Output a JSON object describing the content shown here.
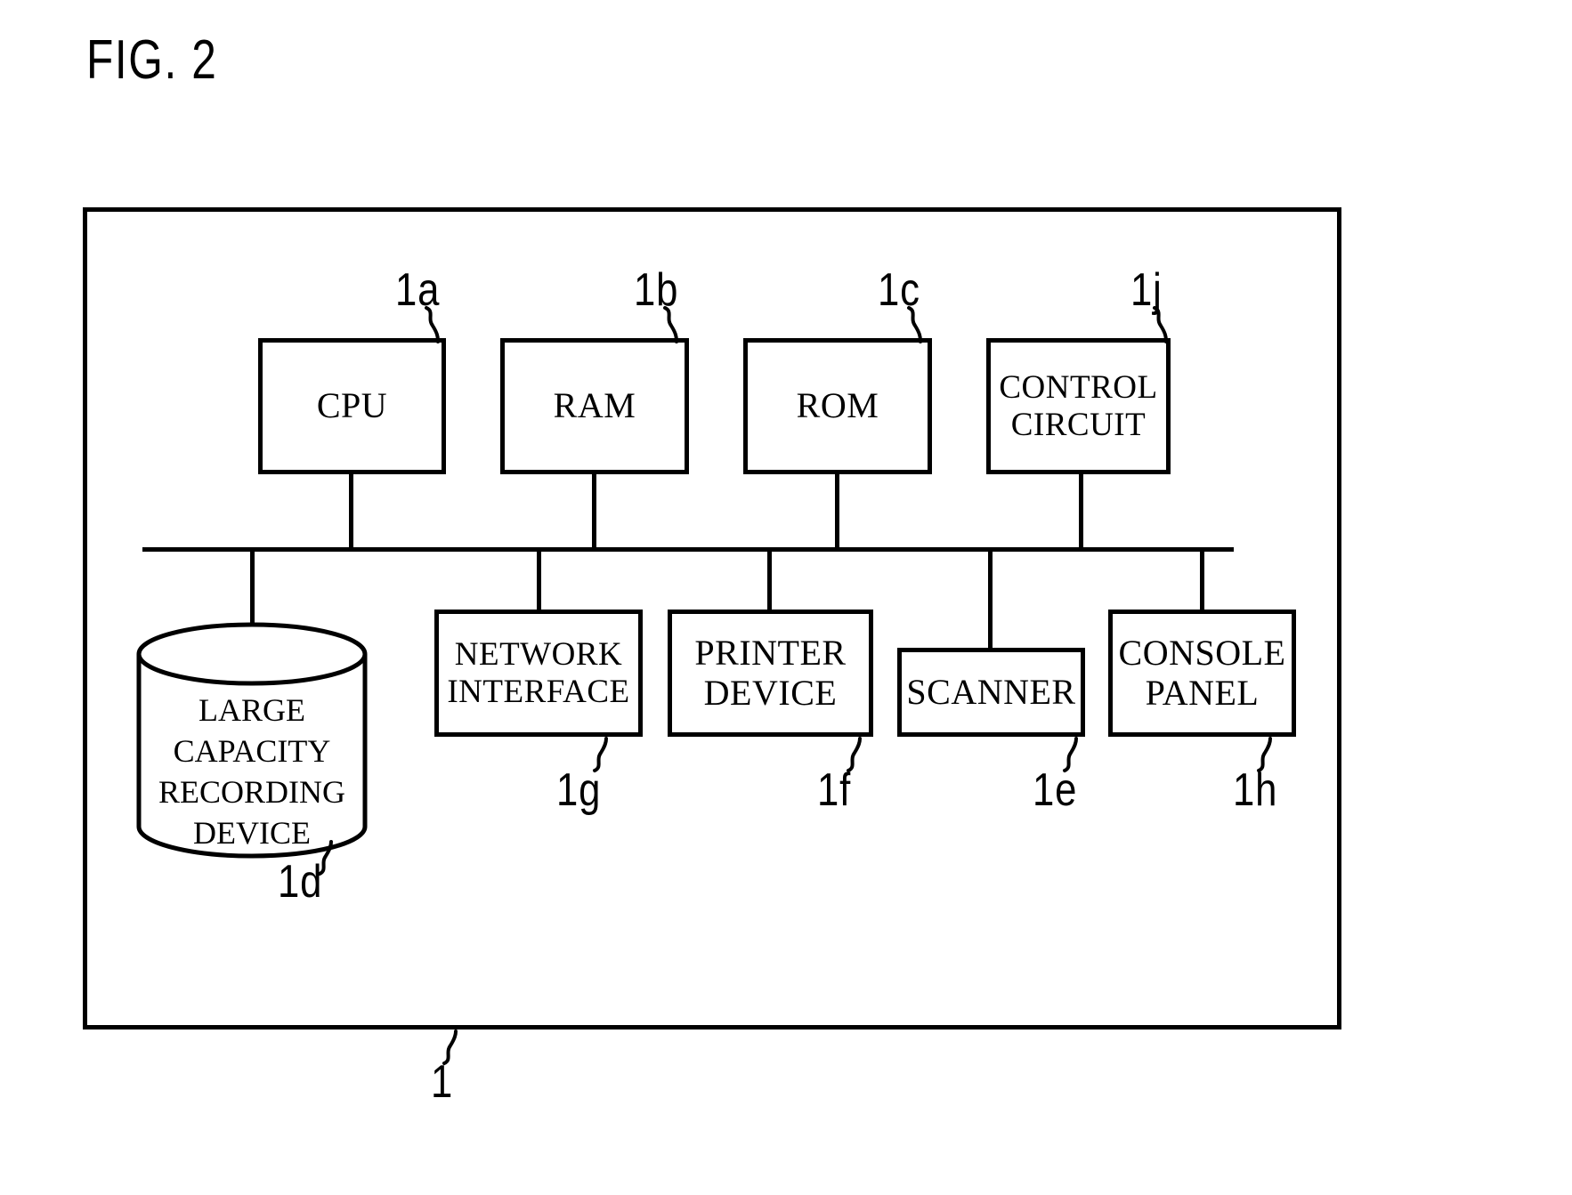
{
  "figure": {
    "title": "FIG. 2",
    "overall_ref": "1"
  },
  "top_row": [
    {
      "label": "CPU",
      "ref": "1a"
    },
    {
      "label": "RAM",
      "ref": "1b"
    },
    {
      "label": "ROM",
      "ref": "1c"
    },
    {
      "label": "CONTROL\nCIRCUIT",
      "ref": "1j"
    }
  ],
  "storage": {
    "label": "LARGE\nCAPACITY\nRECORDING\nDEVICE",
    "ref": "1d",
    "shape": "cylinder-icon"
  },
  "bottom_row": [
    {
      "label": "NETWORK\nINTERFACE",
      "ref": "1g"
    },
    {
      "label": "PRINTER\nDEVICE",
      "ref": "1f"
    },
    {
      "label": "SCANNER",
      "ref": "1e"
    },
    {
      "label": "CONSOLE\nPANEL",
      "ref": "1h"
    }
  ],
  "colors": {
    "line": "#000000",
    "background": "#ffffff"
  }
}
